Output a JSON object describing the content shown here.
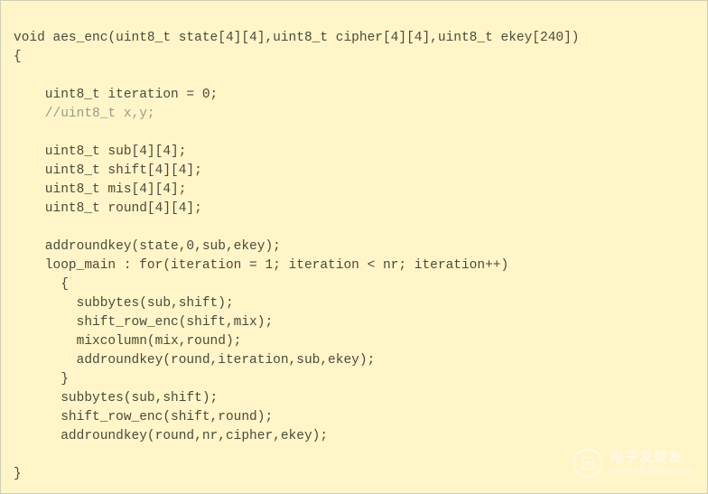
{
  "code": {
    "line1": "void aes_enc(uint8_t state[4][4],uint8_t cipher[4][4],uint8_t ekey[240])",
    "line2": "{",
    "line3": "",
    "line4": "    uint8_t iteration = 0;",
    "line5": "    //uint8_t x,y;",
    "line6": "",
    "line7": "    uint8_t sub[4][4];",
    "line8": "    uint8_t shift[4][4];",
    "line9": "    uint8_t mis[4][4];",
    "line10": "    uint8_t round[4][4];",
    "line11": "",
    "line12": "    addroundkey(state,0,sub,ekey);",
    "line13": "",
    "line14": "    loop_main : for(iteration = 1; iteration < nr; iteration++)",
    "line15": "      {",
    "line16": "        subbytes(sub,shift);",
    "line17": "        shift_row_enc(shift,mix);",
    "line18": "        mixcolumn(mix,round);",
    "line19": "        addroundkey(round,iteration,sub,ekey);",
    "line20": "      }",
    "line21": "      subbytes(sub,shift);",
    "line22": "      shift_row_enc(shift,round);",
    "line23": "      addroundkey(round,nr,cipher,ekey);",
    "line24": "",
    "line25": "}"
  },
  "watermark": {
    "cn": "电子发烧友",
    "url": "www.elecfans.com"
  }
}
